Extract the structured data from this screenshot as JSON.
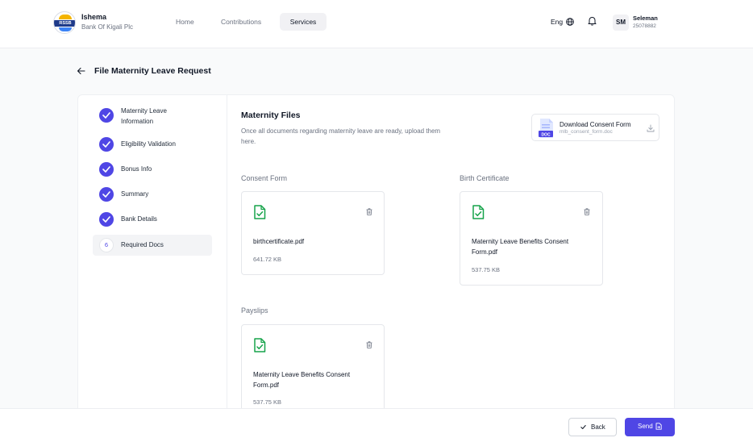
{
  "header": {
    "logo_text": "RSSB",
    "brand_title": "Ishema",
    "brand_subtitle": "Bank Of Kigali Plc",
    "nav": [
      "Home",
      "Contributions",
      "Services"
    ],
    "active_nav": "Services",
    "language": "Eng",
    "user_initials": "SM",
    "user_name": "Seleman",
    "user_id": "25078882"
  },
  "page": {
    "title": "File Maternity Leave Request"
  },
  "steps": [
    {
      "label": "Maternity Leave Information",
      "status": "complete"
    },
    {
      "label": "Eligibility Validation",
      "status": "complete"
    },
    {
      "label": "Bonus Info",
      "status": "complete"
    },
    {
      "label": "Summary",
      "status": "complete"
    },
    {
      "label": "Bank Details",
      "status": "complete"
    },
    {
      "label": "Required Docs",
      "status": "active",
      "number": "6"
    }
  ],
  "section": {
    "title": "Maternity Files",
    "description": "Once all documents regarding maternity leave are ready, upload them here."
  },
  "download": {
    "label": "Download Consent Form",
    "filename": "mlb_consent_form.doc",
    "badge": "DOC"
  },
  "uploads": [
    {
      "label": "Consent Form",
      "file_name": "birthcertificate.pdf",
      "file_size": "641.72 KB"
    },
    {
      "label": "Birth Certificate",
      "file_name": "Maternity Leave Benefits Consent Form.pdf",
      "file_size": "537.75 KB"
    },
    {
      "label": "Payslips",
      "file_name": "Maternity Leave Benefits Consent Form.pdf",
      "file_size": "537.75 KB"
    }
  ],
  "footer": {
    "back_label": "Back",
    "send_label": "Send"
  },
  "colors": {
    "accent": "#4f46e5",
    "success": "#16a34a"
  }
}
